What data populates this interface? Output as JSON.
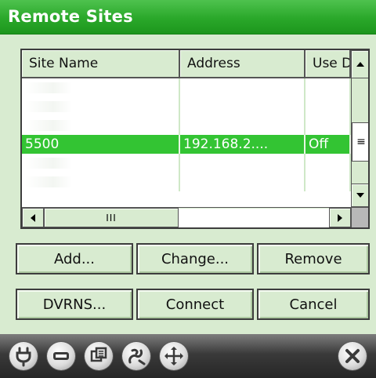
{
  "window": {
    "title": "Remote Sites"
  },
  "list": {
    "columns": [
      "Site Name",
      "Address",
      "Use D"
    ],
    "rows": [
      {
        "site_name": "",
        "address": "",
        "use": "",
        "selected": false
      },
      {
        "site_name": "",
        "address": "",
        "use": "",
        "selected": false
      },
      {
        "site_name": "",
        "address": "",
        "use": "",
        "selected": false
      },
      {
        "site_name": "5500",
        "address": "192.168.2....",
        "use": "Off",
        "selected": true
      },
      {
        "site_name": "",
        "address": "",
        "use": "",
        "selected": false
      },
      {
        "site_name": "",
        "address": "",
        "use": "",
        "selected": false
      }
    ],
    "scroll": {
      "vertical_thumb_glyph": "≡",
      "horizontal_thumb_glyph": "III"
    }
  },
  "buttons": {
    "add": "Add...",
    "change": "Change...",
    "remove": "Remove",
    "dvrns": "DVRNS...",
    "connect": "Connect",
    "cancel": "Cancel"
  },
  "taskbar": {
    "icons": [
      "plug-icon",
      "minus-icon",
      "windows-icon",
      "stylus-icon",
      "move-icon",
      "close-icon"
    ]
  },
  "colors": {
    "title_bar": "#2aa82a",
    "form_background": "#d8ebd0",
    "selection": "#33c433",
    "taskbar": "#3a3a3a"
  }
}
